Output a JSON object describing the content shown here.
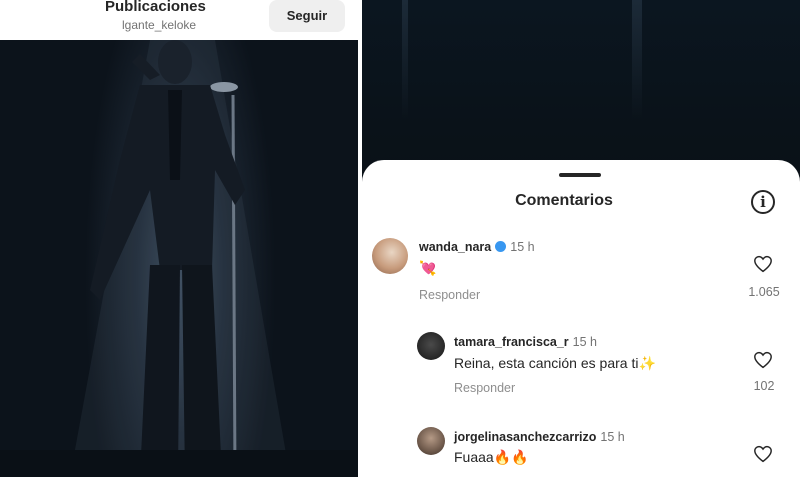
{
  "left": {
    "header_title": "Publicaciones",
    "username": "lgante_keloke",
    "follow_label": "Seguir"
  },
  "comments_sheet": {
    "title": "Comentarios",
    "info_icon": "info-icon",
    "comments": [
      {
        "user": "wanda_nara",
        "verified": true,
        "time": "15 h",
        "text": "💘",
        "reply": "Responder",
        "likes": "1.065"
      },
      {
        "user": "tamara_francisca_r",
        "verified": false,
        "time": "15 h",
        "text": "Reina, esta canción es para ti✨",
        "reply": "Responder",
        "likes": "102"
      },
      {
        "user": "jorgelinasanchezcarrizo",
        "verified": false,
        "time": "15 h",
        "text": "Fuaaa🔥🔥",
        "reply": "",
        "likes": ""
      }
    ]
  },
  "colors": {
    "accent_verified": "#3897f0",
    "photo_bg": "#1f2a37",
    "secondary_text": "#737373"
  }
}
